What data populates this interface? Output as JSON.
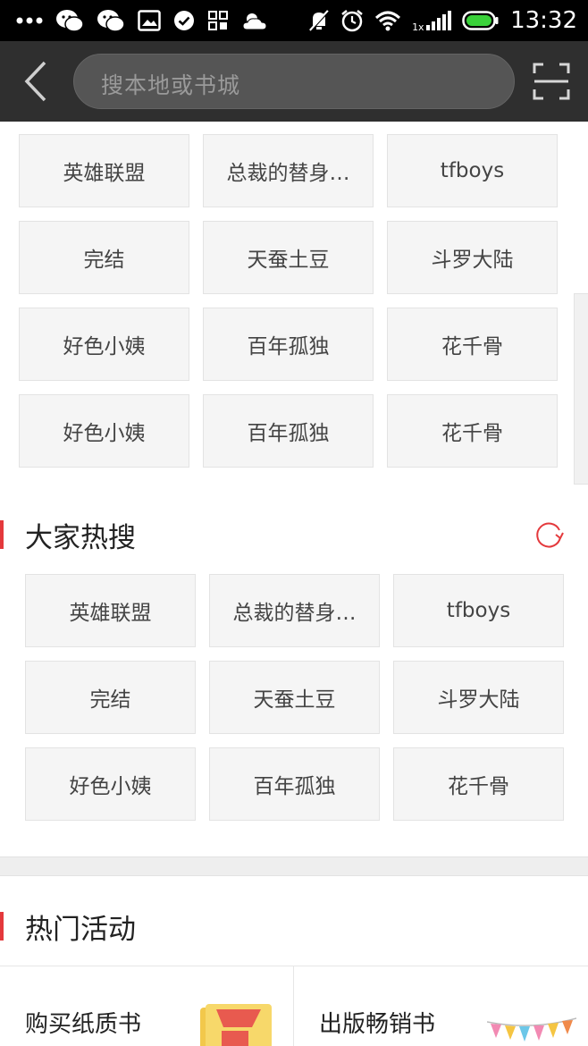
{
  "status_bar": {
    "time": "13:32",
    "network_label": "1x",
    "icons": [
      "more-dots-icon",
      "wechat-icon",
      "wechat-icon",
      "image-icon",
      "check-icon",
      "apps-icon",
      "weather-icon",
      "mute-icon",
      "alarm-icon",
      "wifi-icon",
      "signal-icon",
      "battery-icon"
    ],
    "battery_color": "#3ad13a"
  },
  "top_bar": {
    "back_icon": "back-chevron-icon",
    "search_placeholder": "搜本地或书城",
    "scan_icon": "scan-icon"
  },
  "history_grid": {
    "tags": [
      "英雄联盟",
      "总裁的替身…",
      "tfboys",
      "完结",
      "天蚕土豆",
      "斗罗大陆",
      "好色小姨",
      "百年孤独",
      "花千骨",
      "好色小姨",
      "百年孤独",
      "花千骨"
    ]
  },
  "hot_search": {
    "title": "大家热搜",
    "refresh_icon": "refresh-icon",
    "tags": [
      "英雄联盟",
      "总裁的替身…",
      "tfboys",
      "完结",
      "天蚕土豆",
      "斗罗大陆",
      "好色小姨",
      "百年孤独",
      "花千骨"
    ]
  },
  "activities": {
    "title": "热门活动",
    "items": [
      {
        "label": "购买纸质书",
        "icon": "book-discount-icon"
      },
      {
        "label": "出版畅销书",
        "icon": "bunting-flags-icon"
      }
    ]
  },
  "colors": {
    "accent": "#e4393c",
    "topbar": "#2f2f2f",
    "tag_bg": "#f5f5f5"
  }
}
